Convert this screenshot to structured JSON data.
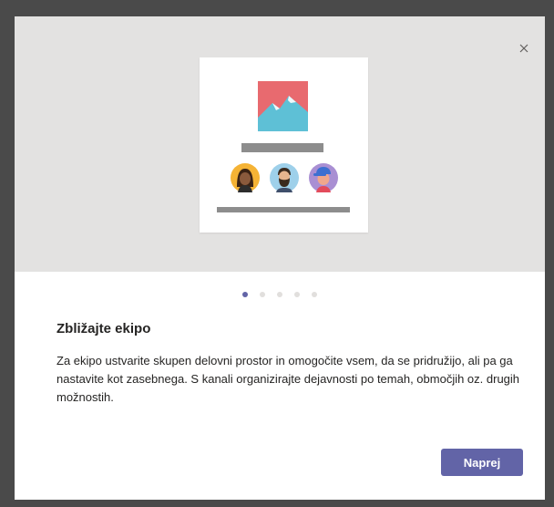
{
  "dialog": {
    "close_icon": "close-icon",
    "illustration": {
      "picture_icon": "mountain-picture-icon",
      "avatars": [
        "avatar-woman",
        "avatar-bearded-man",
        "avatar-cap-person"
      ],
      "colors": {
        "picture_bg": "#e86a6f",
        "mountain": "#5ec0d6",
        "bars": "#8d8d8d",
        "hero_bg": "#e3e2e1"
      }
    },
    "pager": {
      "total": 5,
      "active_index": 0
    },
    "title": "Zbližajte ekipo",
    "body": "Za ekipo ustvarite skupen delovni prostor in omogočite vsem, da se pridružijo, ali pa ga nastavite kot zasebnega. S kanali organizirajte dejavnosti po temah, območjih oz. drugih možnostih.",
    "next_label": "Naprej",
    "accent_color": "#6264a7"
  }
}
